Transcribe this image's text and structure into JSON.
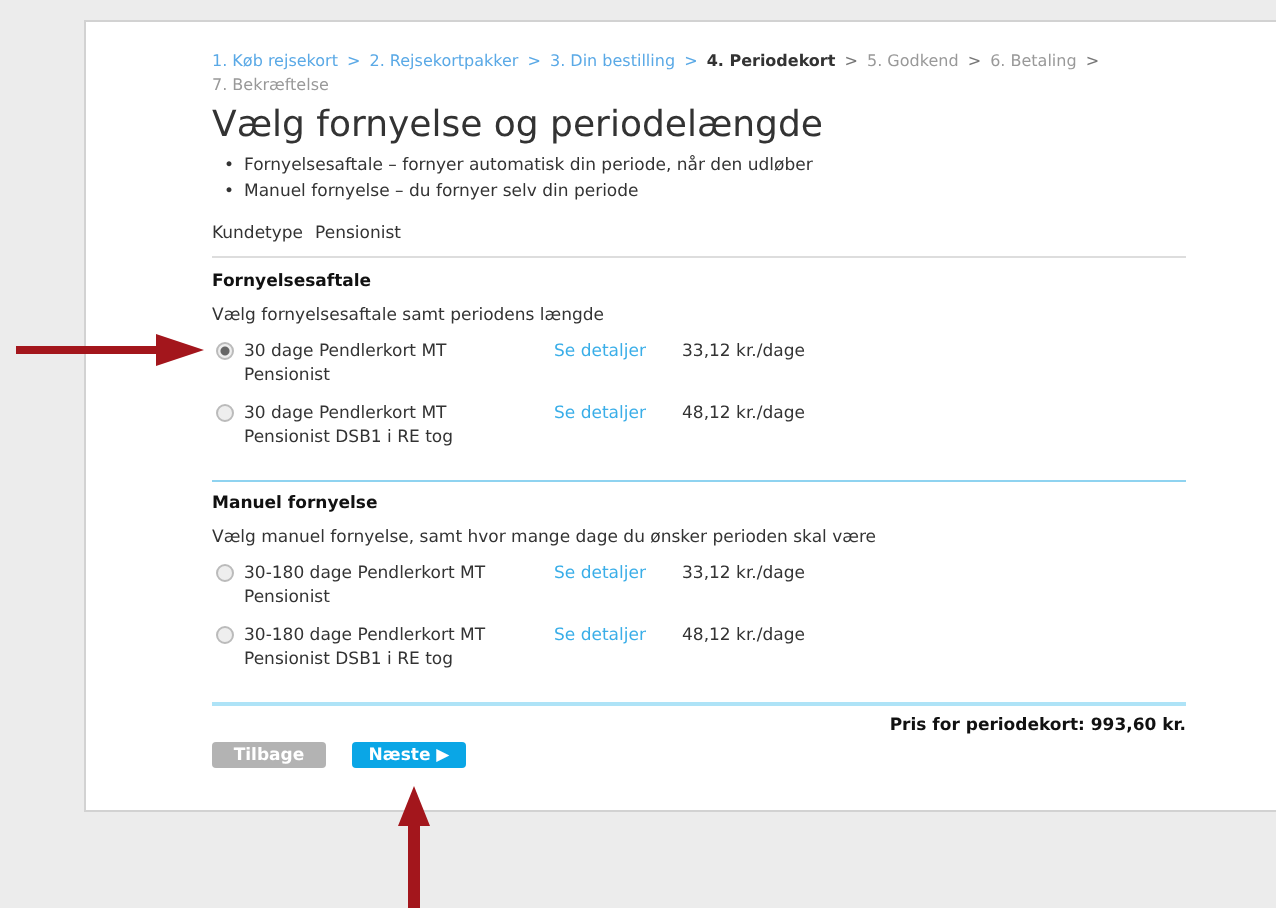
{
  "steps": [
    {
      "label": "1. Køb rejsekort",
      "completed": true,
      "current": false
    },
    {
      "label": "2. Rejsekortpakker",
      "completed": true,
      "current": false
    },
    {
      "label": "3. Din bestilling",
      "completed": true,
      "current": false
    },
    {
      "label": "4. Periodekort",
      "completed": false,
      "current": true
    },
    {
      "label": "5. Godkend",
      "completed": false,
      "current": false
    },
    {
      "label": "6. Betaling",
      "completed": false,
      "current": false
    },
    {
      "label": "7. Bekræftelse",
      "completed": false,
      "current": false
    }
  ],
  "separator": ">",
  "title": "Vælg fornyelse og periodelængde",
  "bullet_marker": "•",
  "bullets": [
    "Fornyelsesaftale – fornyer automatisk din periode, når den udløber",
    "Manuel fornyelse – du fornyer selv din periode"
  ],
  "customer_type": {
    "label": "Kundetype",
    "value": "Pensionist"
  },
  "sections": [
    {
      "heading": "Fornyelsesaftale",
      "intro": "Vælg fornyelsesaftale samt periodens længde",
      "options": [
        {
          "name": "30 dage Pendlerkort MT Pensionist",
          "link": "Se detaljer",
          "price": "33,12 kr./dage",
          "selected": true
        },
        {
          "name": "30 dage Pendlerkort MT Pensionist DSB1 i RE tog",
          "link": "Se detaljer",
          "price": "48,12 kr./dage",
          "selected": false
        }
      ]
    },
    {
      "heading": "Manuel fornyelse",
      "intro": "Vælg manuel fornyelse, samt hvor mange dage du ønsker perioden skal være",
      "options": [
        {
          "name": "30-180 dage Pendlerkort MT Pensionist",
          "link": "Se detaljer",
          "price": "33,12 kr./dage",
          "selected": false
        },
        {
          "name": "30-180 dage Pendlerkort MT Pensionist DSB1 i RE tog",
          "link": "Se detaljer",
          "price": "48,12 kr./dage",
          "selected": false
        }
      ]
    }
  ],
  "total": "Pris for periodekort: 993,60 kr.",
  "buttons": [
    {
      "label": "Tilbage",
      "kind": "back"
    },
    {
      "label": "Næste ▶",
      "kind": "next"
    }
  ]
}
